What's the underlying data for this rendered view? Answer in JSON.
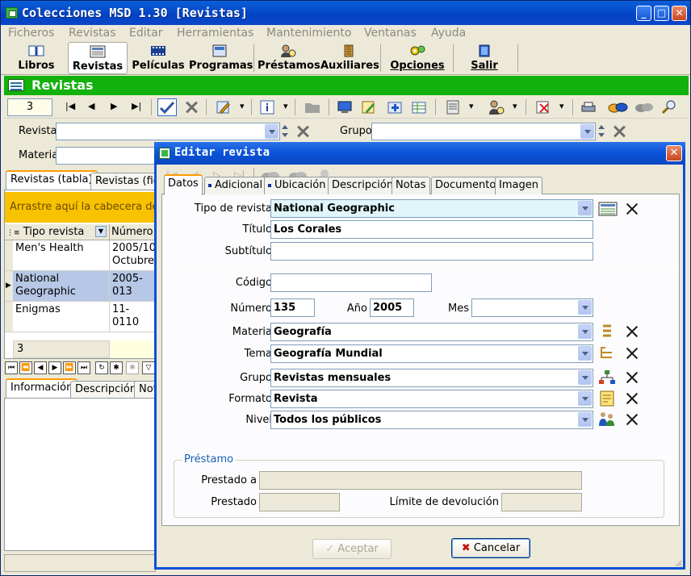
{
  "window": {
    "title": "Colecciones MSD 1.30 [Revistas]"
  },
  "menu": [
    "Ficheros",
    "Revistas",
    "Editar",
    "Herramientas",
    "Mantenimiento",
    "Ventanas",
    "Ayuda"
  ],
  "big_toolbar": {
    "libros": "Libros",
    "revistas": "Revistas",
    "peliculas": "Películas",
    "programas": "Programas",
    "prestamos": "Préstamos",
    "auxiliares": "Auxiliares",
    "opciones": "Opciones",
    "salir": "Salir"
  },
  "section_title": "Revistas",
  "record_number": "3",
  "filters": {
    "revista_label": "Revista",
    "grupo_label": "Grupo",
    "materia_label": "Materia"
  },
  "main_tabs": [
    "Revistas (tabla)",
    "Revistas (fich"
  ],
  "group_drag_text": "Arrastre aquí la cabecera de la",
  "grid": {
    "columns": [
      "Tipo revista",
      "Número d"
    ],
    "rows": [
      {
        "tipo": "Men's Health",
        "numero": "2005/10 Octubre"
      },
      {
        "tipo": "National Geographic",
        "numero": "2005-013"
      },
      {
        "tipo": "Enigmas",
        "numero": "11-0110"
      }
    ],
    "footer_count": "3"
  },
  "bottom_tabs": [
    "Información",
    "Descripción",
    "Not"
  ],
  "dialog": {
    "title": "Editar revista",
    "tabs": [
      "Datos",
      "Adicional",
      "Ubicación",
      "Descripción",
      "Notas",
      "Documento",
      "Imagen"
    ],
    "labels": {
      "tipo": "Tipo de revista",
      "titulo": "Título",
      "subtitulo": "Subtítulo",
      "codigo": "Código",
      "numero": "Número",
      "anio": "Año",
      "mes": "Mes",
      "materia": "Materia",
      "tema": "Tema",
      "grupo": "Grupo",
      "formato": "Formato",
      "nivel": "Nivel",
      "prestamo_group": "Préstamo",
      "prestado_a": "Prestado a",
      "prestado": "Prestado",
      "limite": "Límite de devolución"
    },
    "values": {
      "tipo": "National Geographic",
      "titulo": "Los Corales",
      "subtitulo": "",
      "codigo": "",
      "numero": "135",
      "anio": "2005",
      "mes": "",
      "materia": "Geografía",
      "tema": "Geografía Mundial",
      "grupo": "Revistas mensuales",
      "formato": "Revista",
      "nivel": "Todos los públicos",
      "prestado_a": "",
      "prestado": "",
      "limite": ""
    },
    "buttons": {
      "aceptar": "Aceptar",
      "cancelar": "Cancelar"
    }
  },
  "colors": {
    "title_blue": "#0a52d8",
    "section_green": "#13b10b",
    "drag_yellow": "#f8c200",
    "highlight_field": "#e0f6fb"
  }
}
